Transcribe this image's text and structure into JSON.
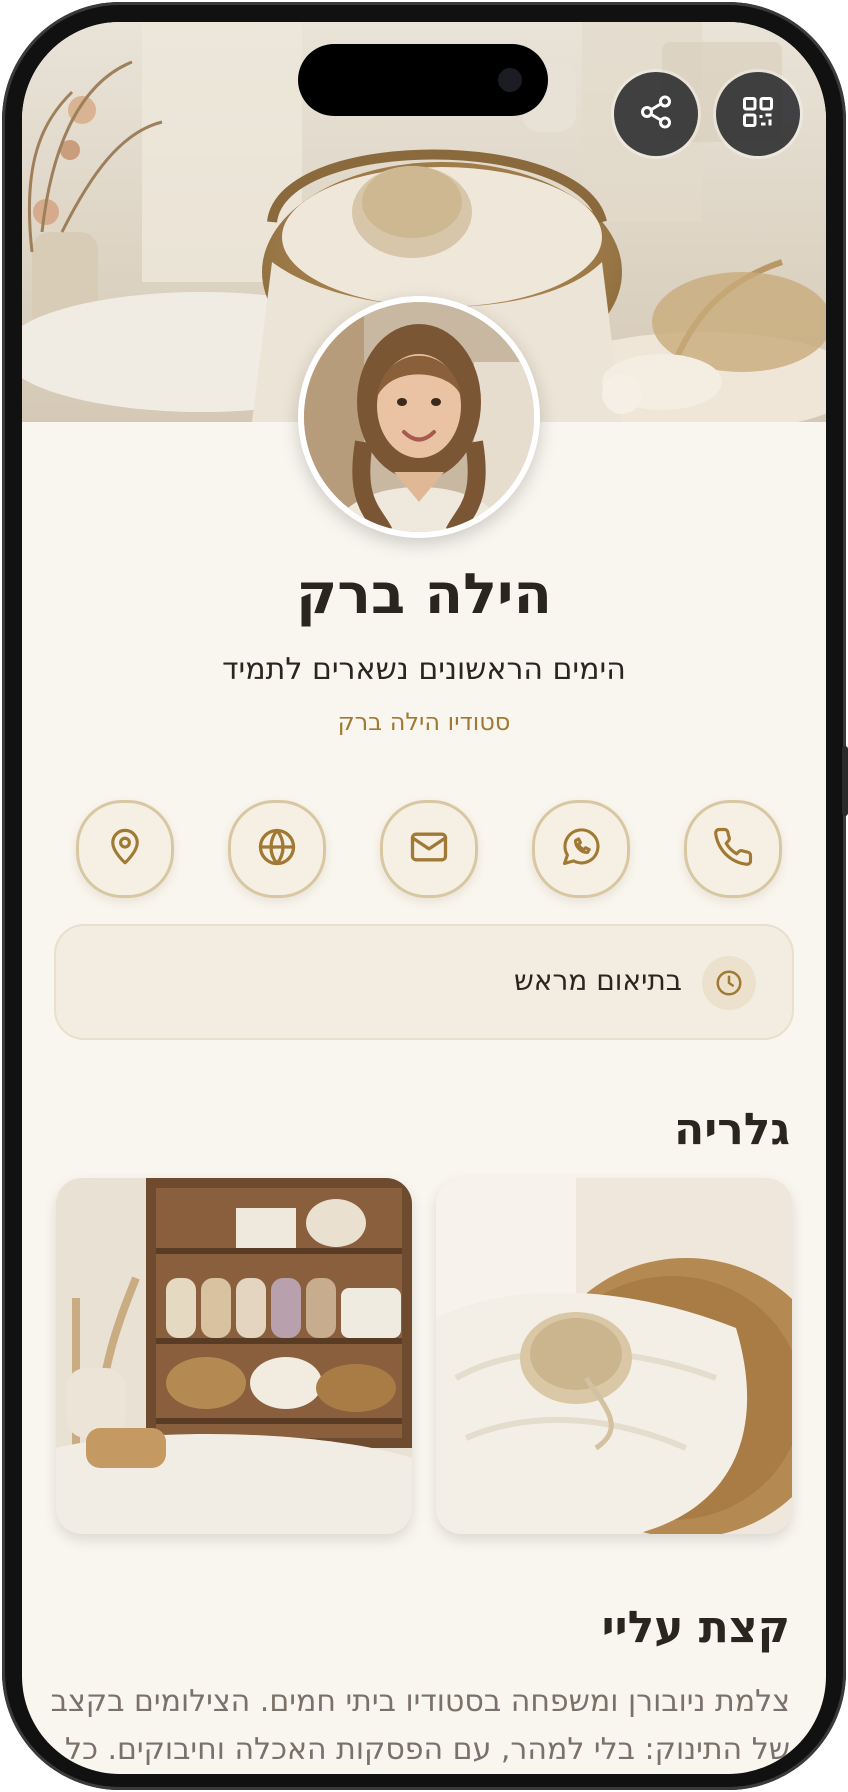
{
  "header": {
    "share_icon": "share-icon",
    "qr_icon": "qr-code-icon"
  },
  "profile": {
    "name": "הילה ברק",
    "tagline": "הימים הראשונים נשארים לתמיד",
    "studio": "סטודיו הילה ברק"
  },
  "contacts": [
    {
      "icon": "phone-icon"
    },
    {
      "icon": "whatsapp-icon"
    },
    {
      "icon": "mail-icon"
    },
    {
      "icon": "globe-icon"
    },
    {
      "icon": "location-pin-icon"
    }
  ],
  "hours": {
    "text": "בתיאום מראש",
    "icon": "clock-icon"
  },
  "gallery": {
    "title": "גלריה"
  },
  "about": {
    "title": "קצת עליי",
    "lines": [
      "צלמת ניובורן ומשפחה בסטודיו ביתי חמים. הצילומים בקצב",
      "של התינוק: בלי למהר, עם הפסקות האכלה וחיבוקים. כל"
    ]
  },
  "colors": {
    "accent": "#a07a34",
    "background": "#f9f6ef",
    "text": "#2b2520"
  }
}
